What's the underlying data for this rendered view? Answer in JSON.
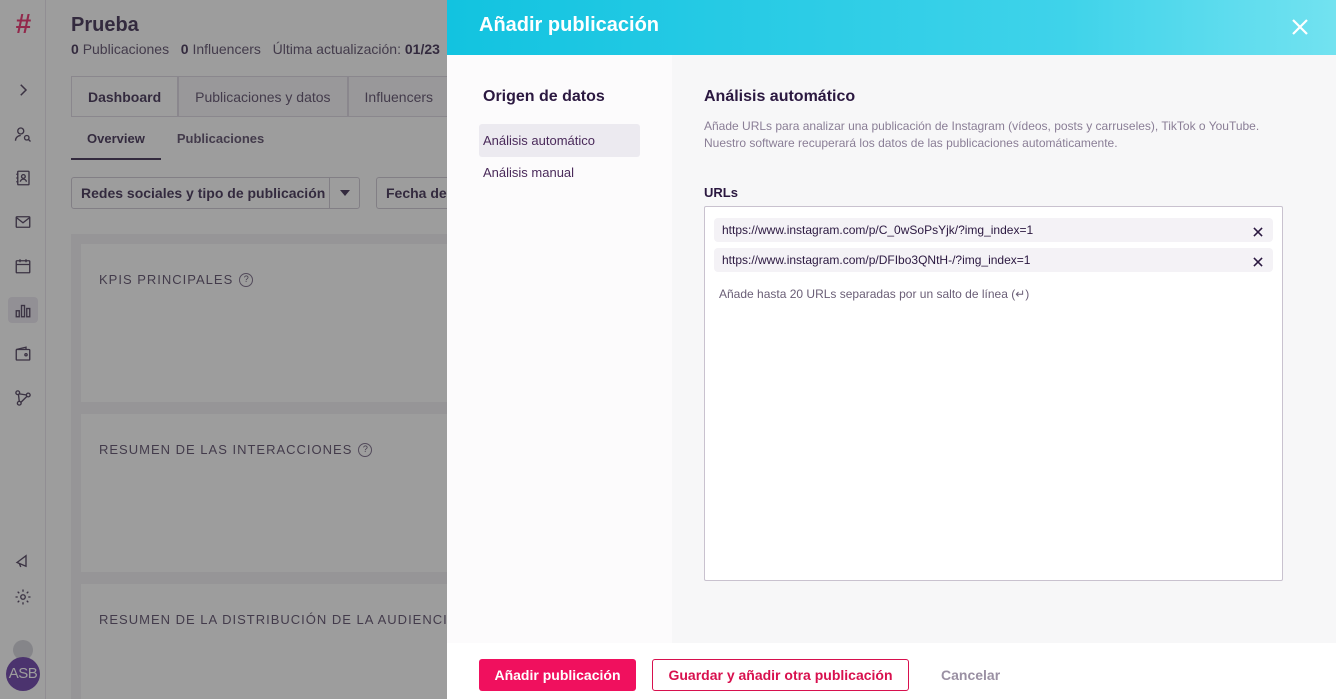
{
  "background": {
    "project_title": "Prueba",
    "meta": {
      "publications_count": "0",
      "publications_label": "Publicaciones",
      "influencers_count": "0",
      "influencers_label": "Influencers",
      "updated_label": "Última actualización:",
      "updated_value": "01/23"
    },
    "tabs": [
      {
        "label": "Dashboard",
        "active": true
      },
      {
        "label": "Publicaciones y datos",
        "active": false
      },
      {
        "label": "Influencers",
        "active": false
      }
    ],
    "subtabs": [
      {
        "label": "Overview",
        "active": true
      },
      {
        "label": "Publicaciones",
        "active": false
      }
    ],
    "filters": {
      "networks": "Redes sociales y tipo de publicación",
      "date": "Fecha de"
    },
    "panels": [
      {
        "title": "KPIS PRINCIPALES"
      },
      {
        "title": "RESUMEN DE LAS INTERACCIONES"
      },
      {
        "title": "RESUMEN DE LA DISTRIBUCIÓN DE LA AUDIENCIA"
      }
    ],
    "avatar_initials": "ASB",
    "logo_glyph": "#"
  },
  "drawer": {
    "title": "Añadir publicación",
    "side": {
      "title": "Origen de datos",
      "items": [
        {
          "label": "Análisis automático",
          "active": true
        },
        {
          "label": "Análisis manual",
          "active": false
        }
      ]
    },
    "main": {
      "title": "Análisis automático",
      "description": "Añade URLs para analizar una publicación de Instagram (vídeos, posts y carruseles), TikTok o YouTube. Nuestro software recuperará los datos de las publicaciones automáticamente.",
      "urls_label": "URLs",
      "urls": [
        "https://www.instagram.com/p/C_0wSoPsYjk/?img_index=1",
        "https://www.instagram.com/p/DFIbo3QNtH-/?img_index=1"
      ],
      "hint": "Añade hasta 20 URLs separadas por un salto de línea (↵)"
    },
    "footer": {
      "primary": "Añadir publicación",
      "secondary": "Guardar y añadir otra publicación",
      "cancel": "Cancelar"
    }
  },
  "colors": {
    "accent": "#f0105e",
    "header_start": "#12c3e0",
    "header_end": "#72e2f0",
    "text_dark": "#2b1840"
  }
}
